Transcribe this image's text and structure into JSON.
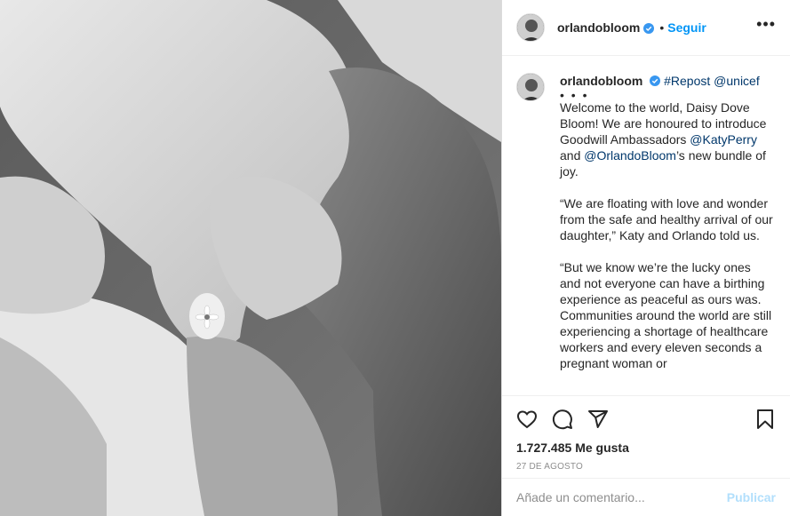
{
  "post": {
    "username": "orlandobloom",
    "follow_separator": "•",
    "follow_label": "Seguir",
    "more_label": "•••"
  },
  "caption": {
    "username": "orlandobloom",
    "repost": "#Repost",
    "repost_user": "@unicef",
    "dots": "• • •",
    "p1_a": "Welcome to the world, Daisy Dove Bloom! We are honoured to introduce Goodwill Ambassadors ",
    "p1_mention1": "@KatyPerry",
    "p1_b": " and ",
    "p1_mention2": "@OrlandoBloom",
    "p1_c": "’s new bundle of joy.",
    "p2": "“We are floating with love and wonder from the safe and healthy arrival of our daughter,” Katy and Orlando told us.",
    "p3": "“But we know we’re the lucky ones and not everyone can have a birthing experience as peaceful as ours was. Communities around the world are still experiencing a shortage of healthcare workers and every eleven seconds a pregnant woman or"
  },
  "actions": {
    "like_icon": "heart-icon",
    "comment_icon": "comment-icon",
    "share_icon": "share-icon",
    "save_icon": "bookmark-icon",
    "likes_count": "1.727.485",
    "likes_label": "Me gusta",
    "date": "27 DE AGOSTO"
  },
  "comment_input": {
    "placeholder": "Añade un comentario...",
    "value": "",
    "publish_label": "Publicar"
  },
  "colors": {
    "follow": "#0095f6",
    "publish_disabled": "#b2dffc",
    "verified": "#3897f0"
  }
}
